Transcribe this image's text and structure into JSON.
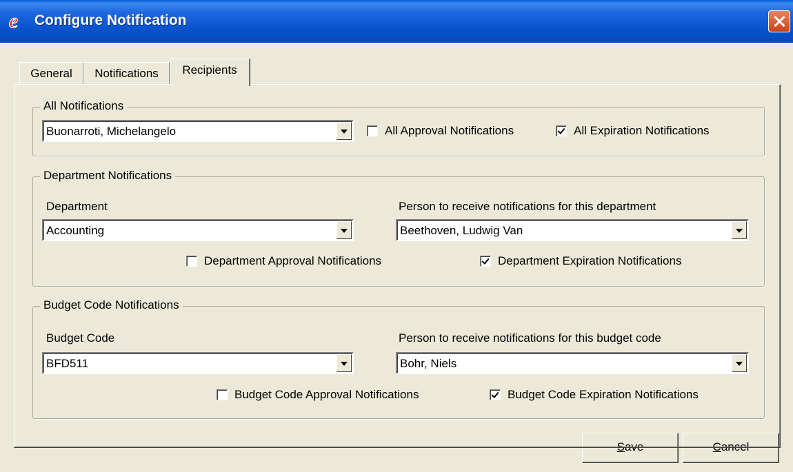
{
  "window": {
    "title": "Configure Notification"
  },
  "tabs": [
    {
      "label": "General"
    },
    {
      "label": "Notifications"
    },
    {
      "label": "Recipients"
    }
  ],
  "all_notifications": {
    "legend": "All Notifications",
    "recipient": "Buonarroti, Michelangelo",
    "approval": {
      "label": "All Approval Notifications",
      "checked": false
    },
    "expiration": {
      "label": "All Expiration Notifications",
      "checked": true
    }
  },
  "department_notifications": {
    "legend": "Department Notifications",
    "department_label": "Department",
    "department_value": "Accounting",
    "person_label": "Person to receive notifications for this department",
    "person_value": "Beethoven, Ludwig Van",
    "approval": {
      "label": "Department Approval Notifications",
      "checked": false
    },
    "expiration": {
      "label": "Department Expiration Notifications",
      "checked": true
    }
  },
  "budget_code_notifications": {
    "legend": "Budget Code Notifications",
    "budget_code_label": "Budget Code",
    "budget_code_value": "BFD511",
    "person_label": "Person to receive notifications for this budget code",
    "person_value": "Bohr, Niels",
    "approval": {
      "label": "Budget Code Approval Notifications",
      "checked": false
    },
    "expiration": {
      "label": "Budget Code Expiration Notifications",
      "checked": true
    }
  },
  "buttons": {
    "save": {
      "accel": "S",
      "rest": "ave"
    },
    "cancel": {
      "accel": "C",
      "rest": "ancel"
    }
  }
}
